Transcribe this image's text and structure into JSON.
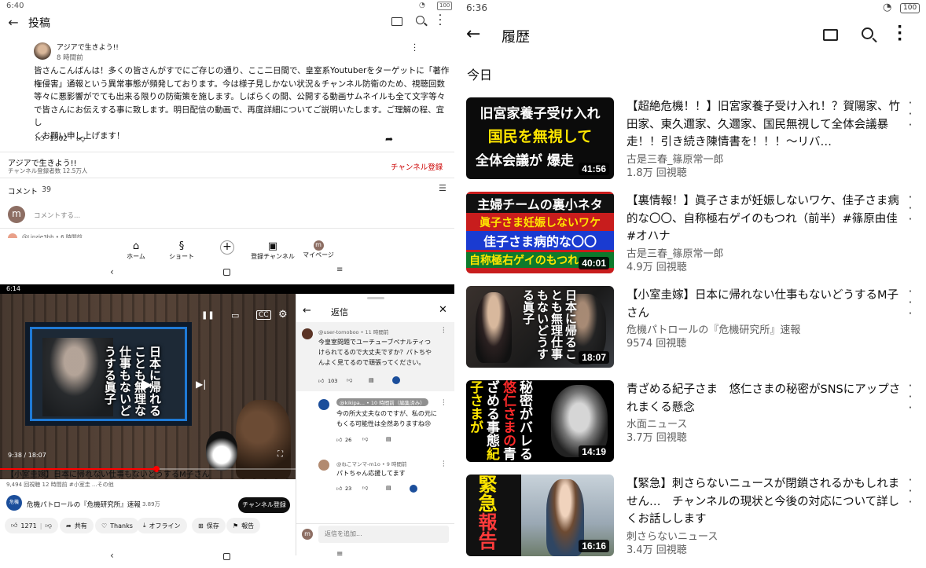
{
  "post_screen": {
    "status_time": "6:40",
    "battery": "100",
    "header_title": "投稿",
    "author_name": "アジアで生きよう!!",
    "post_time": "8 時間前",
    "body_lines": [
      "皆さんこんばんは！多くの皆さんがすでにご存じの通り、ここ二日間で、皇室系Youtuberをターゲットに「著作",
      "権侵害」通報という異常事態が頻発しております。今は様子見しかない状況＆チャンネル防衛のため、視聴回数",
      "等々に悪影響がでても出来る限りの防衛策を施します。しばらくの間、公開する動画サムネイルも全て文字等々",
      "で皆さんにお伝えする事に致します。明日配信の動画で、再度詳細についてご説明いたします。ご理解の程、宜し",
      "くお願い申し上げます！"
    ],
    "likes": "1302",
    "channel_name": "アジアで生きよう!!",
    "subscribers": "チャンネル登録者数 12.5万人",
    "subscribe_label": "チャンネル登録",
    "comments_label": "コメント",
    "comments_count": "39",
    "comment_placeholder": "コメントする...",
    "avatar_letter": "m",
    "peek_comment": "@Linzie3bh • 6 時間前",
    "nav": [
      "ホーム",
      "ショート",
      "",
      "登録チャンネル",
      "マイページ"
    ]
  },
  "video_screen": {
    "status_time": "6:14",
    "time_display": "9:38 / 18:07",
    "progress": 0.53,
    "overlay_caption": "日本に帰れることも無理な仕事もないどうする眞子",
    "title": "【小室圭嫁】日本に帰れない仕事もないどうするM子さん",
    "meta": "9,494 回視聴  12 時間前  #小室圭  ...その他",
    "channel_name": "危機パトロールの『危機研究所』速報",
    "channel_subs": "3.89万",
    "subscribe_label": "チャンネル登録",
    "chips": [
      "1271",
      "共有",
      "Thanks",
      "オフライン",
      "保存",
      "報告"
    ],
    "reply_sheet": {
      "title": "返信",
      "replies": [
        {
          "author": "@user-tomoboo • 11 時間前",
          "text": [
            "今皇室問題でユーチューブペナルティつ",
            "けられてるので大丈夫ですか？パトちや",
            "んよく見てるので頑張ってください。"
          ],
          "likes": "103"
        },
        {
          "author": "@kikipa... • 10 時間前（編集済み）",
          "text": [
            "今の所大丈夫なのですが、私の元に",
            "もくる可能性は全然ありますね😢"
          ],
          "likes": "26"
        },
        {
          "author": "@ねこマンマ-m1o • 9 時間前",
          "text": [
            "パトちゃん応援してます"
          ],
          "likes": "23"
        }
      ],
      "input_placeholder": "返信を追加...",
      "avatar_letter": "m"
    }
  },
  "history_screen": {
    "status_time": "6:36",
    "battery": "100",
    "header_title": "履歴",
    "section_label": "今日",
    "videos": [
      {
        "title": "【超絶危機！！】旧宮家養子受け入れ！？賀陽家、竹田家、東久邇家、久邇家、国民無視して全体会議暴走！！引き続き陳情書を！！！～リバ…",
        "channel": "古是三春_篠原常一郎",
        "views": "1.8万 回視聴",
        "duration": "41:56",
        "thumb_lines": [
          "旧宮家養子受け入れ",
          "国民を無視して",
          "全体会議が 爆走"
        ]
      },
      {
        "title": "【裏情報！】眞子さまが妊娠しないワケ、佳子さま病的な〇〇、自称極右ゲイのもつれ（前半）#篠原由佳　#オハナ",
        "channel": "古是三春_篠原常一郎",
        "views": "4.9万 回視聴",
        "duration": "40:01",
        "thumb_lines": [
          "主婦チームの裏小ネタ",
          "眞子さま妊娠しないワケ",
          "佳子さま病的な〇〇",
          "自称極右ゲイのもつれ"
        ]
      },
      {
        "title": "【小室圭嫁】日本に帰れない仕事もないどうするM子さん",
        "channel": "危機パトロールの『危機研究所』速報",
        "views": "9574 回視聴",
        "duration": "18:07",
        "thumb_lines": [
          "日本に帰る",
          "ことも無理",
          "仕事もない",
          "どうする眞子"
        ]
      },
      {
        "title": "青ざめる紀子さま　悠仁さまの秘密がSNSにアップされまくる懸念",
        "channel": "水面ニュース",
        "views": "3.7万 回視聴",
        "duration": "14:19",
        "thumb_lines": [
          "紀子さまが",
          "青ざめる事態",
          "悠仁さまの",
          "秘密がバレる"
        ]
      },
      {
        "title": "【緊急】刺さらないニュースが閉鎖されるかもしれません…　チャンネルの現状と今後の対応について詳しくお話しします",
        "channel": "刺さらないニュース",
        "views": "3.4万 回視聴",
        "duration": "16:16",
        "thumb_lines": [
          "緊急",
          "報告"
        ]
      }
    ]
  },
  "icons": {
    "back": "back-arrow-icon",
    "cast": "cast-icon",
    "search": "search-icon",
    "more": "more-vert-icon",
    "like": "thumb-up-icon",
    "dislike": "thumb-down-icon",
    "share": "share-icon"
  }
}
